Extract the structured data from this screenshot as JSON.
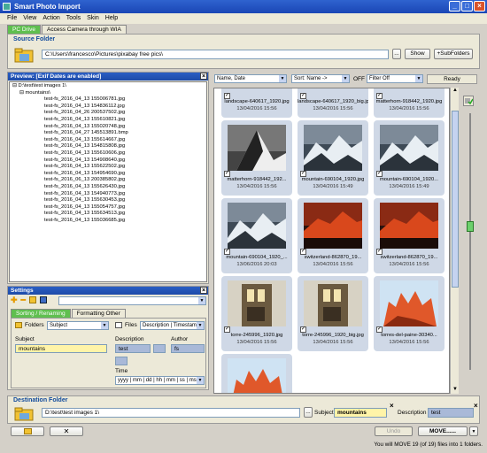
{
  "window": {
    "title": "Smart Photo Import"
  },
  "menu": [
    "File",
    "View",
    "Action",
    "Tools",
    "Skin",
    "Help"
  ],
  "source_tabs": [
    {
      "label": "PC Drive",
      "active": true
    },
    {
      "label": "Access Camera through WIA",
      "active": false
    }
  ],
  "source": {
    "header": "Source Folder",
    "path": "C:\\Users\\francesco\\Pictures\\pixabay free pics\\",
    "browse_label": "...",
    "show_label": "Show",
    "subfolders_label": "+SubFolders"
  },
  "preview": {
    "header": "Preview: [Exif Dates are enabled]",
    "root": "D:\\test\\test images 1\\",
    "folder": "mountains\\",
    "files": [
      "test-fs_2016_04_13 155006781.jpg",
      "test-fs_2016_04_13 154836112.jpg",
      "test-fs_2016_04_26 200537502.jpg",
      "test-fs_2016_04_13 155610821.jpg",
      "test-fs_2016_04_13 155020748.jpg",
      "test-fs_2016_04_27 145513891.bmp",
      "test-fs_2016_04_13 155614667.jpg",
      "test-fs_2016_04_13 154815808.jpg",
      "test-fs_2016_04_13 155610606.jpg",
      "test-fs_2016_04_13 154908640.jpg",
      "test-fs_2016_04_13 155622502.jpg",
      "test-fs_2016_04_13 154954690.jpg",
      "test-fs_2016_06_13 200385802.jpg",
      "test-fs_2016_04_13 155626430.jpg",
      "test-fs_2016_04_13 154940773.jpg",
      "test-fs_2016_04_13 155630453.jpg",
      "test-fs_2016_04_13 155054757.jpg",
      "test-fs_2016_04_13 155634513.jpg",
      "test-fs_2016_04_13 155036685.jpg"
    ]
  },
  "settings": {
    "header": "Settings",
    "tabs": [
      {
        "label": "Sorting / Renaming",
        "active": true
      },
      {
        "label": "Formatting Other",
        "active": false
      }
    ],
    "folders_label": "Folders",
    "folders_value": "Subject",
    "files_label": "Files",
    "files_value": "Description | Timestamp",
    "subject_label": "Subject",
    "subject_value": "mountains",
    "description_label": "Description",
    "description_value": "test",
    "author_label": "Author",
    "author_value": "fs",
    "time_label": "Time",
    "time_value": "yyyy | mm | dd | hh | mm | ss | ms"
  },
  "toolbar": {
    "sort_value": "Name, Date",
    "sort_name_value": "Sort: Name ->",
    "off_label": "OFF",
    "filter_value": "Filter Off",
    "status": "Ready"
  },
  "thumbnails": [
    {
      "name": "landscape-640617_1920.jpg",
      "date": "13/04/2016 15:56",
      "theme": "partial"
    },
    {
      "name": "landscape-640617_1920_big.jpg",
      "date": "13/04/2016 15:56",
      "theme": "partial"
    },
    {
      "name": "matterhorn-918442_1920.jpg",
      "date": "13/04/2016 15:56",
      "theme": "partial"
    },
    {
      "name": "matterhorn-918442_192...",
      "date": "13/04/2016 15:56",
      "theme": "matterhorn"
    },
    {
      "name": "mountain-690104_1920.jpg",
      "date": "13/04/2016 15:49",
      "theme": "mountain"
    },
    {
      "name": "mountain-690104_1920...",
      "date": "13/04/2016 15:49",
      "theme": "mountain"
    },
    {
      "name": "mountain-690104_1920_...",
      "date": "13/06/2016 20:03",
      "theme": "mountain"
    },
    {
      "name": "switzerland-862870_19...",
      "date": "13/04/2016 15:56",
      "theme": "sunset"
    },
    {
      "name": "switzerland-862870_19...",
      "date": "13/04/2016 15:56",
      "theme": "sunset"
    },
    {
      "name": "torre-245996_1920.jpg",
      "date": "13/04/2016 15:56",
      "theme": "tower"
    },
    {
      "name": "torre-245996_1920_big.jpg",
      "date": "13/04/2016 15:56",
      "theme": "tower"
    },
    {
      "name": "torres-del-paine-30340...",
      "date": "13/04/2016 15:56",
      "theme": "torres"
    },
    {
      "name": "",
      "date": "",
      "theme": "torres"
    }
  ],
  "destination": {
    "header": "Destination Folder",
    "path": "D:\\test\\test images 1\\",
    "browse_label": "...",
    "subject_label": "Subject",
    "subject_value": "mountains",
    "description_label": "Description",
    "description_value": "test"
  },
  "actions": {
    "undo_label": "Undo",
    "move_label": "MOVE......",
    "status_text": "You will MOVE 19 (of 19) files into 1 folders."
  },
  "colors": {
    "titlebar": "#1d4aa8",
    "active_tab": "#5fbf4f",
    "highlight_yellow": "#fff4a8",
    "highlight_blue": "#a9b9d8"
  }
}
